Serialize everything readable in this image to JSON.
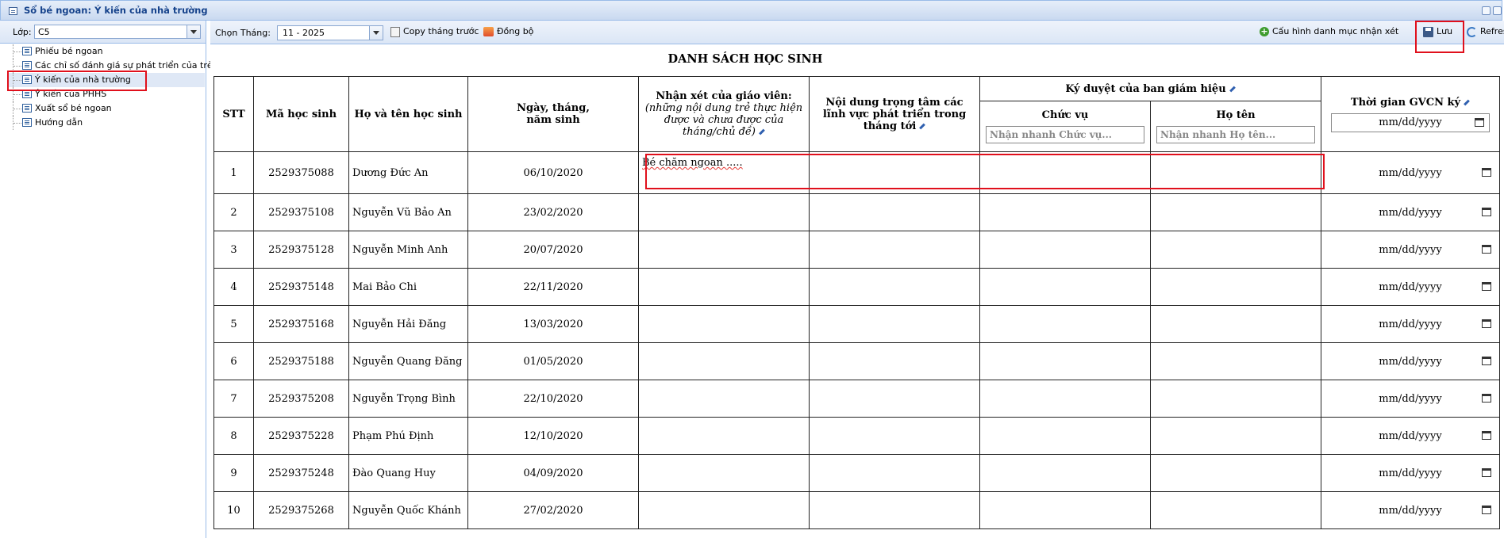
{
  "window": {
    "title": "Sổ bé ngoan: Ý kiến của nhà trường"
  },
  "left_panel": {
    "lop_label": "Lớp:",
    "lop_value": "C5",
    "tree": [
      {
        "label": "Phiếu bé ngoan"
      },
      {
        "label": "Các chỉ số đánh giá sự phát triển của trẻ"
      },
      {
        "label": "Ý kiến của nhà trường",
        "selected": true
      },
      {
        "label": "Ý kiến của PHHS"
      },
      {
        "label": "Xuất sổ bé ngoan"
      },
      {
        "label": "Hướng dẫn"
      }
    ]
  },
  "toolbar": {
    "month_label": "Chọn Tháng:",
    "month_value": "11 - 2025",
    "copy_label": "Copy tháng trước",
    "sync_label": "Đồng bộ",
    "config_label": "Cấu hình danh mục nhận xét",
    "save_label": "Lưu",
    "refresh_label": "Refresh"
  },
  "table": {
    "title": "DANH SÁCH HỌC SINH",
    "headers": {
      "stt": "STT",
      "ma_hs": "Mã học sinh",
      "ho_ten": "Họ và tên học sinh",
      "ngay_sinh_1": "Ngày, tháng,",
      "ngay_sinh_2": "năm sinh",
      "nhan_xet_bold": "Nhận xét của giáo viên:",
      "nhan_xet_note": "(những nội dung trẻ thực hiện được và chưa được của tháng/chủ đề)",
      "noi_dung": "Nội dung trọng tâm các lĩnh vực phát triển trong tháng tới",
      "ky_duyet": "Ký duyệt của ban giám hiệu",
      "chuc_vu": "Chức vụ",
      "ho_ten_bgh": "Họ tên",
      "thoi_gian": "Thời gian GVCN ký"
    },
    "placeholders": {
      "chuc_vu": "Nhận nhanh Chức vụ...",
      "ho_ten": "Nhận nhanh Họ tên...",
      "date": "mm/dd/yyyy"
    },
    "rows": [
      {
        "stt": "1",
        "ma": "2529375088",
        "ten": "Dương Đức An",
        "ngay": "06/10/2020",
        "nhan_xet": "Bé chăm ngoan ....."
      },
      {
        "stt": "2",
        "ma": "2529375108",
        "ten": "Nguyễn Vũ Bảo An",
        "ngay": "23/02/2020",
        "nhan_xet": ""
      },
      {
        "stt": "3",
        "ma": "2529375128",
        "ten": "Nguyễn Minh Anh",
        "ngay": "20/07/2020",
        "nhan_xet": ""
      },
      {
        "stt": "4",
        "ma": "2529375148",
        "ten": "Mai Bảo Chi",
        "ngay": "22/11/2020",
        "nhan_xet": ""
      },
      {
        "stt": "5",
        "ma": "2529375168",
        "ten": "Nguyễn Hải Đăng",
        "ngay": "13/03/2020",
        "nhan_xet": ""
      },
      {
        "stt": "6",
        "ma": "2529375188",
        "ten": "Nguyễn Quang Đăng",
        "ngay": "01/05/2020",
        "nhan_xet": ""
      },
      {
        "stt": "7",
        "ma": "2529375208",
        "ten": "Nguyễn Trọng Bình",
        "ngay": "22/10/2020",
        "nhan_xet": ""
      },
      {
        "stt": "8",
        "ma": "2529375228",
        "ten": "Phạm Phú Định",
        "ngay": "12/10/2020",
        "nhan_xet": ""
      },
      {
        "stt": "9",
        "ma": "2529375248",
        "ten": "Đào Quang Huy",
        "ngay": "04/09/2020",
        "nhan_xet": ""
      },
      {
        "stt": "10",
        "ma": "2529375268",
        "ten": "Nguyễn Quốc Khánh",
        "ngay": "27/02/2020",
        "nhan_xet": ""
      }
    ]
  },
  "colors": {
    "highlight": "#e0101c",
    "panel_border": "#99bbe8",
    "title_text": "#15428b"
  }
}
